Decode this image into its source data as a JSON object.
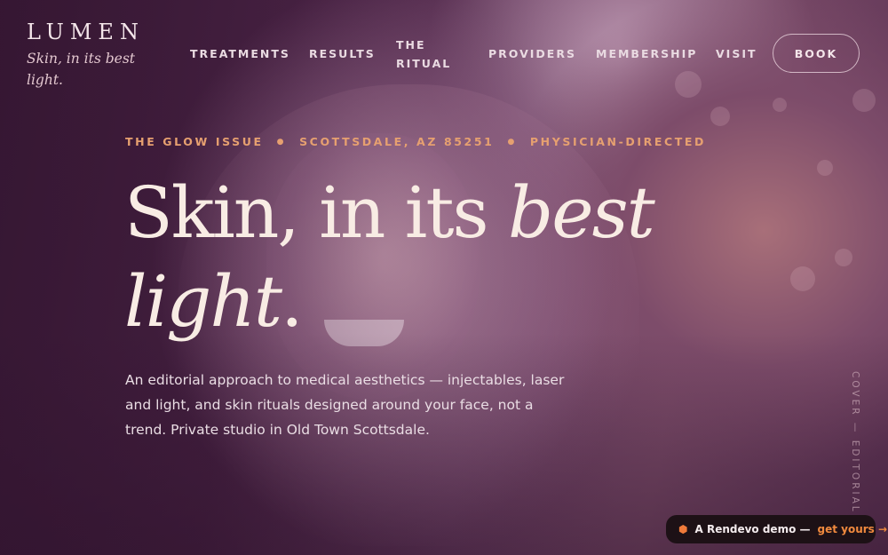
{
  "brand": {
    "logo": "LUMEN",
    "tagline": "Skin, in its best light."
  },
  "nav": {
    "items": [
      "TREATMENTS",
      "RESULTS",
      "THE RITUAL",
      "PROVIDERS",
      "MEMBERSHIP",
      "VISIT"
    ],
    "ritual_line1": "THE",
    "ritual_line2": "RITUAL",
    "book_label": "BOOK"
  },
  "hero": {
    "meta": [
      "THE GLOW ISSUE",
      "SCOTTSDALE, AZ 85251",
      "PHYSICIAN-DIRECTED"
    ],
    "headline_line1": "Skin, in its ",
    "headline_italic1": "best",
    "headline_italic2": "light",
    "headline_end": ".",
    "lede": "An editorial approach to medical aesthetics — injectables, laser and light, and skin rituals designed around your face, not a trend. Private studio in Old Town Scottsdale.",
    "vertical_caption": "COVER — EDITORIAL MO"
  },
  "badge": {
    "text": "A Rendevo demo —",
    "link": "get yours →"
  },
  "colors": {
    "accent": "#e6a070",
    "headline": "#f8ece4",
    "badge_bg": "#1d1116",
    "badge_link": "#f08a3e"
  }
}
